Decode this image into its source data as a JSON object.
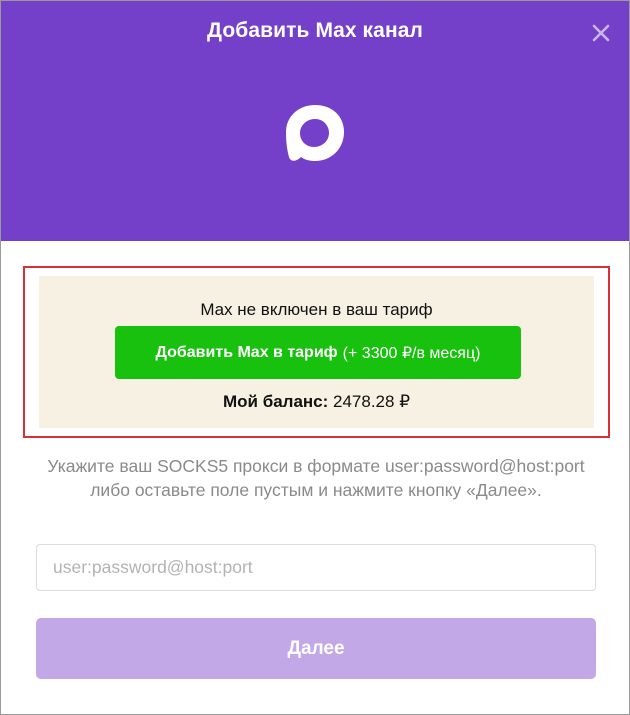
{
  "dialog": {
    "title": "Добавить Max канал",
    "close_icon": "close-icon",
    "logo_icon": "max-logo-icon"
  },
  "notice": {
    "text": "Max не включен в ваш тариф",
    "add_button": {
      "label": "Добавить Max в тариф",
      "price": "(+ 3300 ₽/в месяц)"
    },
    "balance_label": "Мой баланс:",
    "balance_value": "2478.28 ₽"
  },
  "proxy": {
    "hint": "Укажите ваш SOCKS5 прокси в формате user:password@host:port либо оставьте поле пустым и нажмите кнопку «Далее».",
    "placeholder": "user:password@host:port",
    "value": ""
  },
  "next_button": {
    "label": "Далее"
  },
  "colors": {
    "header": "#7540c9",
    "add_button": "#17c10e",
    "notice_bg": "#f6f1e3",
    "highlight_border": "#d7303a",
    "next_button": "#c2a8e6"
  }
}
